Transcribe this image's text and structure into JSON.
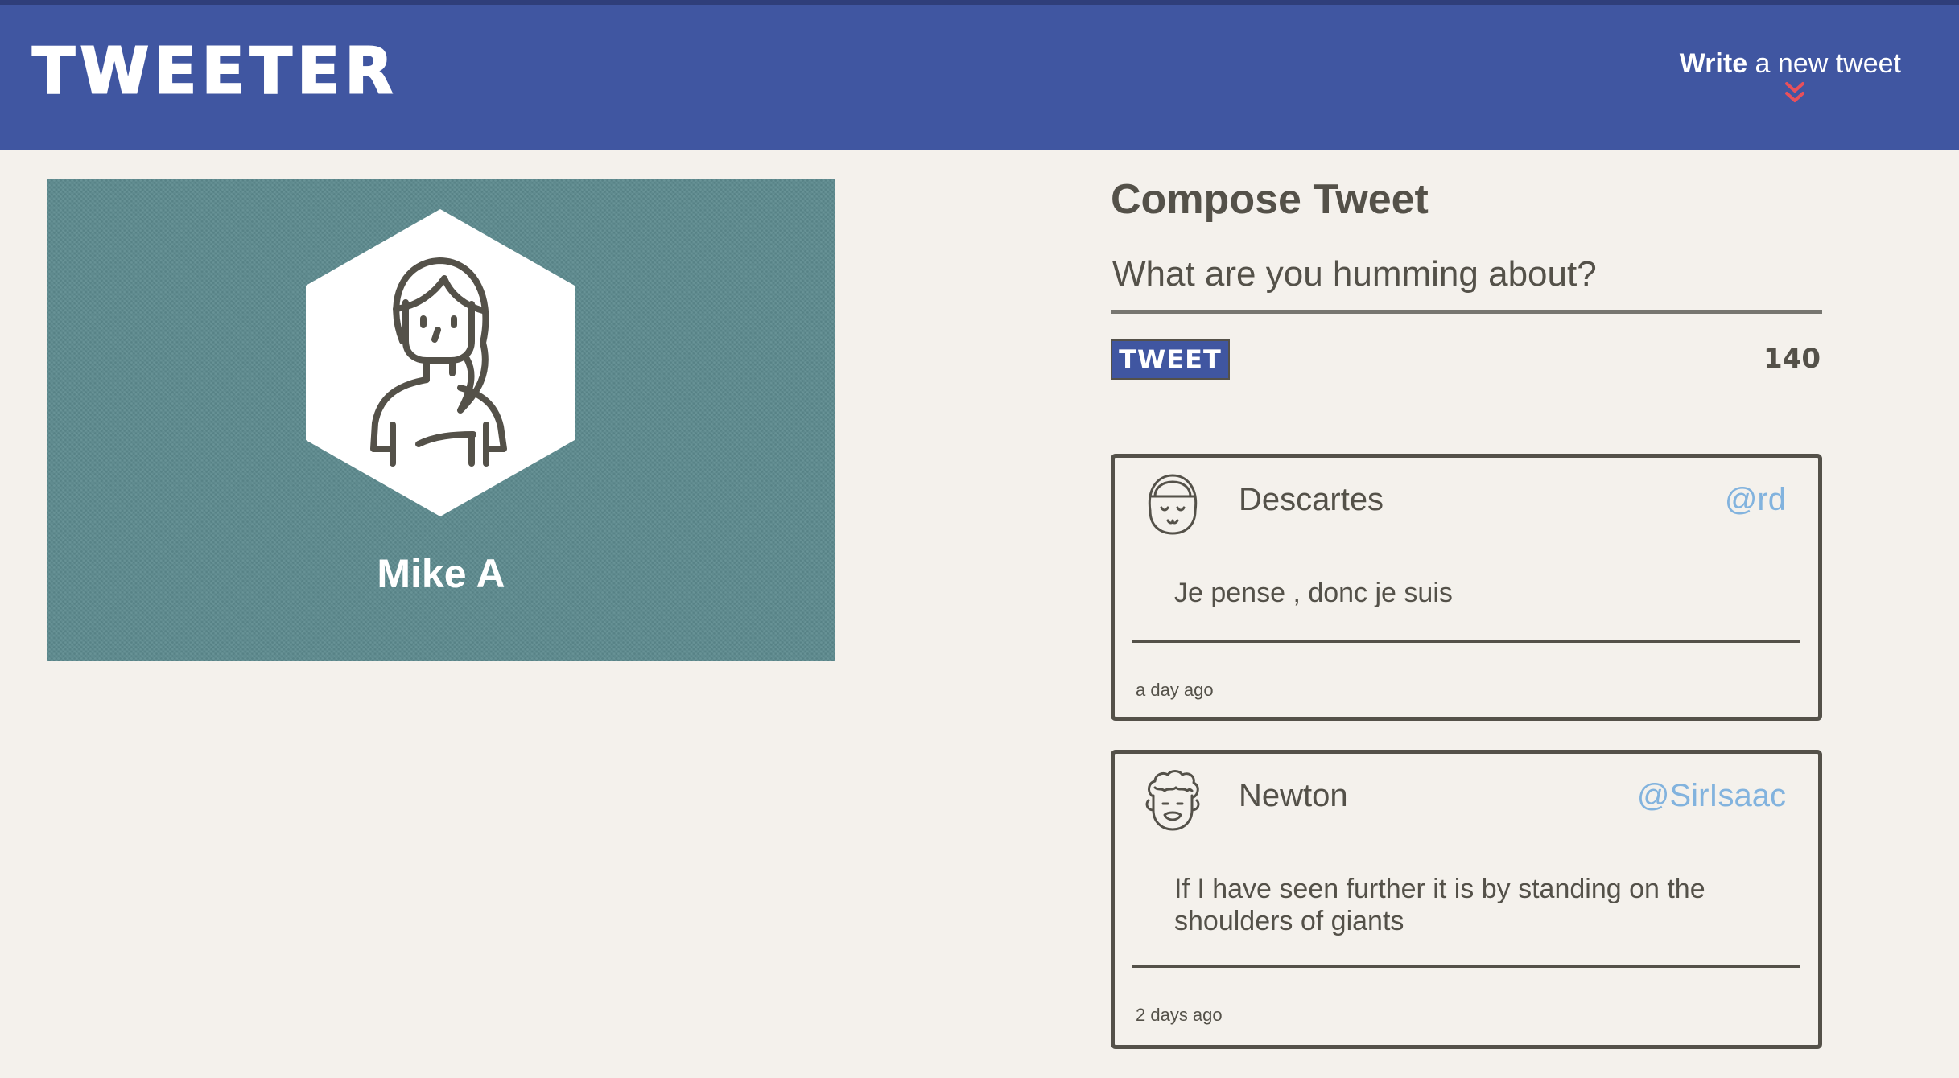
{
  "nav": {
    "brand": "TWEETER",
    "write_strong": "Write",
    "write_rest": " a new tweet",
    "chevron_icon": "double-chevron-down-icon",
    "chevron_color": "#e8505b"
  },
  "profile": {
    "name": "Mike A",
    "avatar_icon": "woman-avatar-icon",
    "banner_color": "#5d8b8f"
  },
  "compose": {
    "title": "Compose Tweet",
    "placeholder": "What are you humming about?",
    "button_label": "TWEET",
    "counter": "140"
  },
  "tweets": [
    {
      "author": "Descartes",
      "handle": "@rd",
      "text": "Je pense , donc je suis",
      "time": "a day ago",
      "avatar_icon": "bangs-face-avatar-icon"
    },
    {
      "author": "Newton",
      "handle": "@SirIsaac",
      "text": "If I have seen further it is by standing on the shoulders of giants",
      "time": "2 days ago",
      "avatar_icon": "curly-hair-avatar-icon"
    }
  ],
  "colors": {
    "nav_bg": "#4056a1",
    "page_bg": "#f4f1ec",
    "text": "#545149",
    "handle": "#82b3de"
  }
}
